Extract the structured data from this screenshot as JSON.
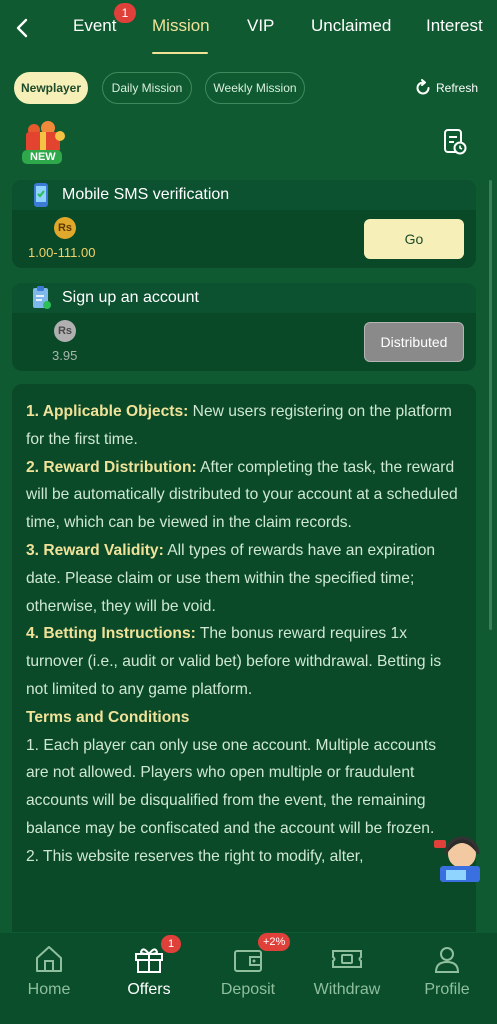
{
  "header": {
    "tabs": [
      {
        "label": "Event",
        "badge": "1"
      },
      {
        "label": "Mission"
      },
      {
        "label": "VIP"
      },
      {
        "label": "Unclaimed"
      },
      {
        "label": "Interest"
      }
    ],
    "active_tab": "Mission"
  },
  "subtabs": {
    "items": [
      "Newplayer",
      "Daily Mission",
      "Weekly Mission"
    ],
    "active": "Newplayer",
    "refresh_label": "Refresh"
  },
  "new_badge_label": "NEW",
  "tasks": [
    {
      "title": "Mobile SMS verification",
      "currency": "Rs",
      "reward": "1.00-111.00",
      "button": "Go",
      "state": "available"
    },
    {
      "title": "Sign up an account",
      "currency": "Rs",
      "reward": "3.95",
      "button": "Distributed",
      "state": "distributed"
    }
  ],
  "rules": {
    "items": [
      {
        "label": "1. Applicable Objects:",
        "text": " New users registering on the platform for the first time."
      },
      {
        "label": "2. Reward Distribution:",
        "text": " After completing the task, the reward will be automatically distributed to your account at a scheduled time, which can be viewed in the claim records."
      },
      {
        "label": "3. Reward Validity:",
        "text": " All types of rewards have an expiration date. Please claim or use them within the specified time; otherwise, they will be void."
      },
      {
        "label": "4. Betting Instructions:",
        "text": " The bonus reward requires 1x turnover (i.e., audit or valid bet) before withdrawal. Betting is not limited to any game platform."
      }
    ],
    "terms_heading": "Terms and Conditions",
    "terms": [
      "1. Each player can only use one account. Multiple accounts are not allowed. Players who open multiple or fraudulent accounts will be disqualified from the event, the remaining balance may be confiscated and the account will be frozen.",
      "2. This website reserves the right to modify, alter,"
    ]
  },
  "bottom_nav": [
    {
      "label": "Home",
      "icon": "home-icon"
    },
    {
      "label": "Offers",
      "icon": "gift-icon",
      "badge": "1"
    },
    {
      "label": "Deposit",
      "icon": "wallet-icon",
      "badge": "+2%"
    },
    {
      "label": "Withdraw",
      "icon": "withdraw-icon"
    },
    {
      "label": "Profile",
      "icon": "profile-icon"
    }
  ],
  "bottom_nav_active": "Offers",
  "colors": {
    "background": "#0f5a31",
    "accent": "#f1e29a",
    "button_go": "#f6f0b8",
    "button_disabled": "#8a8a8a",
    "badge": "#e0403a"
  }
}
